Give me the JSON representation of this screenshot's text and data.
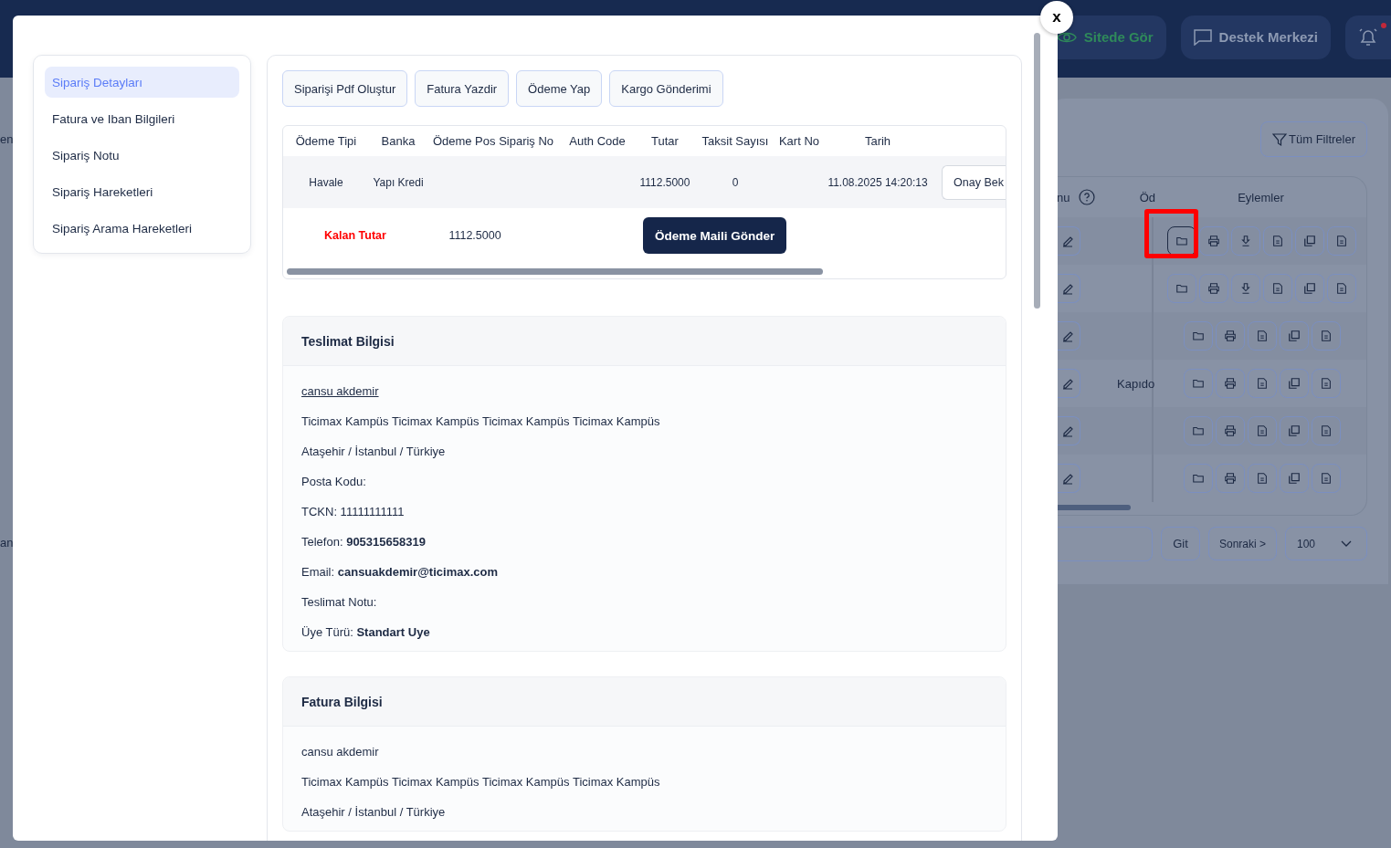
{
  "topbar": {
    "buttons": [
      {
        "label": "Sitede Gör",
        "kind": "view"
      },
      {
        "label": "Destek Merkezi",
        "kind": "support"
      }
    ],
    "notification": {
      "unread": true
    }
  },
  "background_page": {
    "edge_texts": [
      "en",
      "an"
    ],
    "filter_button": "Tüm Filtreler",
    "table": {
      "columns": [
        {
          "label": "nu",
          "help": true
        },
        {
          "label": "Öd"
        },
        {
          "label": "Eylemler"
        }
      ],
      "rows": [
        {
          "highlighted": true,
          "actions": [
            {
              "kind": "folder"
            },
            {
              "kind": "printer"
            },
            {
              "kind": "download"
            },
            {
              "kind": "document"
            },
            {
              "kind": "copy"
            },
            {
              "kind": "document"
            }
          ]
        },
        {
          "highlighted": false,
          "actions": [
            {
              "kind": "folder"
            },
            {
              "kind": "printer"
            },
            {
              "kind": "download"
            },
            {
              "kind": "document"
            },
            {
              "kind": "copy"
            },
            {
              "kind": "document"
            }
          ]
        },
        {
          "highlighted": false,
          "actions": [
            {
              "kind": "folder"
            },
            {
              "kind": "printer"
            },
            {
              "kind": "document"
            },
            {
              "kind": "copy"
            },
            {
              "kind": "document"
            }
          ]
        },
        {
          "highlighted": false,
          "payment": "Kapıdo",
          "actions": [
            {
              "kind": "folder"
            },
            {
              "kind": "printer"
            },
            {
              "kind": "document"
            },
            {
              "kind": "copy"
            },
            {
              "kind": "document"
            }
          ]
        },
        {
          "highlighted": false,
          "actions": [
            {
              "kind": "folder"
            },
            {
              "kind": "printer"
            },
            {
              "kind": "document"
            },
            {
              "kind": "copy"
            },
            {
              "kind": "document"
            }
          ]
        },
        {
          "highlighted": false,
          "actions": [
            {
              "kind": "folder"
            },
            {
              "kind": "printer"
            },
            {
              "kind": "document"
            },
            {
              "kind": "copy"
            },
            {
              "kind": "document"
            }
          ]
        }
      ]
    },
    "pagination": {
      "go": "Git",
      "next": "Sonraki >",
      "page_size": "100"
    }
  },
  "modal": {
    "close": "x",
    "sidebar": {
      "items": [
        {
          "label": "Sipariş Detayları",
          "selected": true
        },
        {
          "label": "Fatura ve Iban Bilgileri",
          "selected": false
        },
        {
          "label": "Sipariş Notu",
          "selected": false
        },
        {
          "label": "Sipariş Hareketleri",
          "selected": false
        },
        {
          "label": "Sipariş Arama Hareketleri",
          "selected": false
        }
      ]
    },
    "toolbar": [
      "Siparişi Pdf Oluştur",
      "Fatura Yazdir",
      "Ödeme Yap",
      "Kargo Gönderimi"
    ],
    "payments": {
      "columns": [
        "Ödeme Tipi",
        "Banka",
        "Ödeme Pos Sipariş No",
        "Auth Code",
        "Tutar",
        "Taksit Sayısı",
        "Kart No",
        "Tarih"
      ],
      "rows": [
        {
          "cells": [
            "Havale",
            "Yapı Kredi",
            null,
            null,
            "1112.5000",
            "0",
            null,
            "11.08.2025 14:20:13"
          ],
          "status": "Onay Bek"
        }
      ],
      "remaining": {
        "label": "Kalan Tutar",
        "amount": "1112.5000",
        "button": "Ödeme Maili Gönder"
      }
    },
    "sections": [
      {
        "title": "Teslimat Bilgisi",
        "lines": [
          {
            "kind": "link",
            "text": "cansu akdemir"
          },
          {
            "kind": "text",
            "text": "Ticimax Kampüs Ticimax Kampüs Ticimax Kampüs Ticimax Kampüs"
          },
          {
            "kind": "text",
            "text": "Ataşehir / İstanbul / Türkiye"
          },
          {
            "kind": "text",
            "text": "Posta Kodu:"
          },
          {
            "kind": "text",
            "text": "TCKN: 11111111111"
          },
          {
            "kind": "text",
            "text": "Telefon: **905315658319**"
          },
          {
            "kind": "text",
            "text": "Email: **cansuakdemir@ticimax.com**"
          },
          {
            "kind": "text",
            "text": "Teslimat Notu:"
          },
          {
            "kind": "text",
            "text": "Üye Türü: **Standart Uye**"
          }
        ]
      },
      {
        "title": "Fatura Bilgisi",
        "lines": [
          {
            "kind": "text",
            "text": "cansu akdemir"
          },
          {
            "kind": "text",
            "text": "Ticimax Kampüs Ticimax Kampüs Ticimax Kampüs Ticimax Kampüs"
          },
          {
            "kind": "text",
            "text": "Ataşehir / İstanbul / Türkiye"
          }
        ]
      }
    ]
  }
}
